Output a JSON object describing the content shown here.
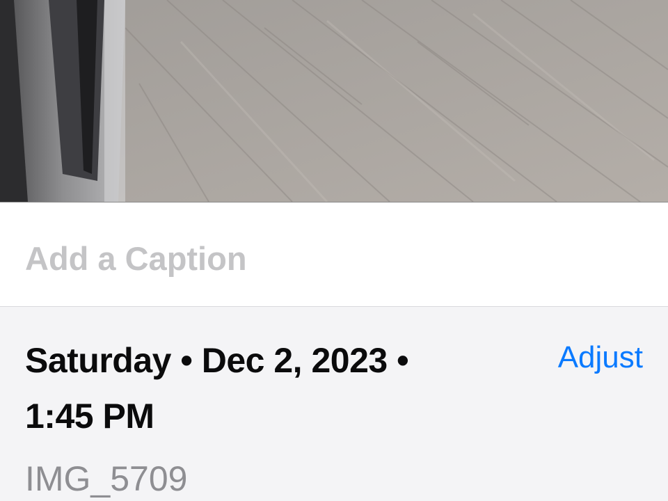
{
  "caption": {
    "placeholder": "Add a Caption"
  },
  "info": {
    "date_line_1": "Saturday • Dec 2, 2023 •",
    "date_line_2": "1:45 PM",
    "adjust_label": "Adjust",
    "filename": "IMG_5709"
  },
  "colors": {
    "accent": "#0a7aff",
    "placeholder": "#c4c4c6",
    "secondary_text": "#8e8e92",
    "panel_bg": "#f4f4f6"
  }
}
